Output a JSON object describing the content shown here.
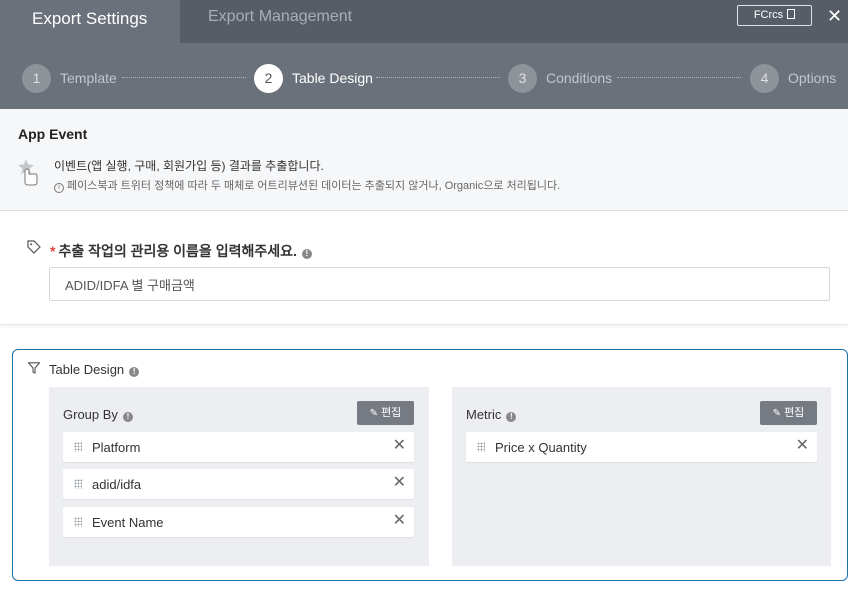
{
  "tabs": {
    "active": "Export Settings",
    "inactive": "Export Management"
  },
  "topbar": {
    "badge": "FCrcs",
    "close": "✕"
  },
  "steps": [
    {
      "num": "1",
      "label": "Template",
      "active": false
    },
    {
      "num": "2",
      "label": "Table Design",
      "active": true
    },
    {
      "num": "3",
      "label": "Conditions",
      "active": false
    },
    {
      "num": "4",
      "label": "Options",
      "active": false
    }
  ],
  "event": {
    "title": "App Event",
    "description": "이벤트(앱 실행, 구매, 회원가입 등) 결과를 추출합니다.",
    "note": "페이스북과 트위터 정책에 따라 두 매체로 어트리뷰션된 데이터는 추출되지 않거나, Organic으로 처리됩니다."
  },
  "name_field": {
    "required_mark": "*",
    "label": "추출 작업의 관리용 이름을 입력해주세요.",
    "value": "ADID/IDFA 별 구매금액"
  },
  "table_design": {
    "title": "Table Design",
    "group_by": {
      "title": "Group By",
      "edit_label": "편집",
      "items": [
        "Platform",
        "adid/idfa",
        "Event Name"
      ]
    },
    "metric": {
      "title": "Metric",
      "edit_label": "편집",
      "items": [
        "Price x Quantity"
      ]
    }
  },
  "colors": {
    "accent": "#1f6fa8",
    "header": "#575d66",
    "stepper": "#6b717a",
    "required": "#e0443a"
  }
}
